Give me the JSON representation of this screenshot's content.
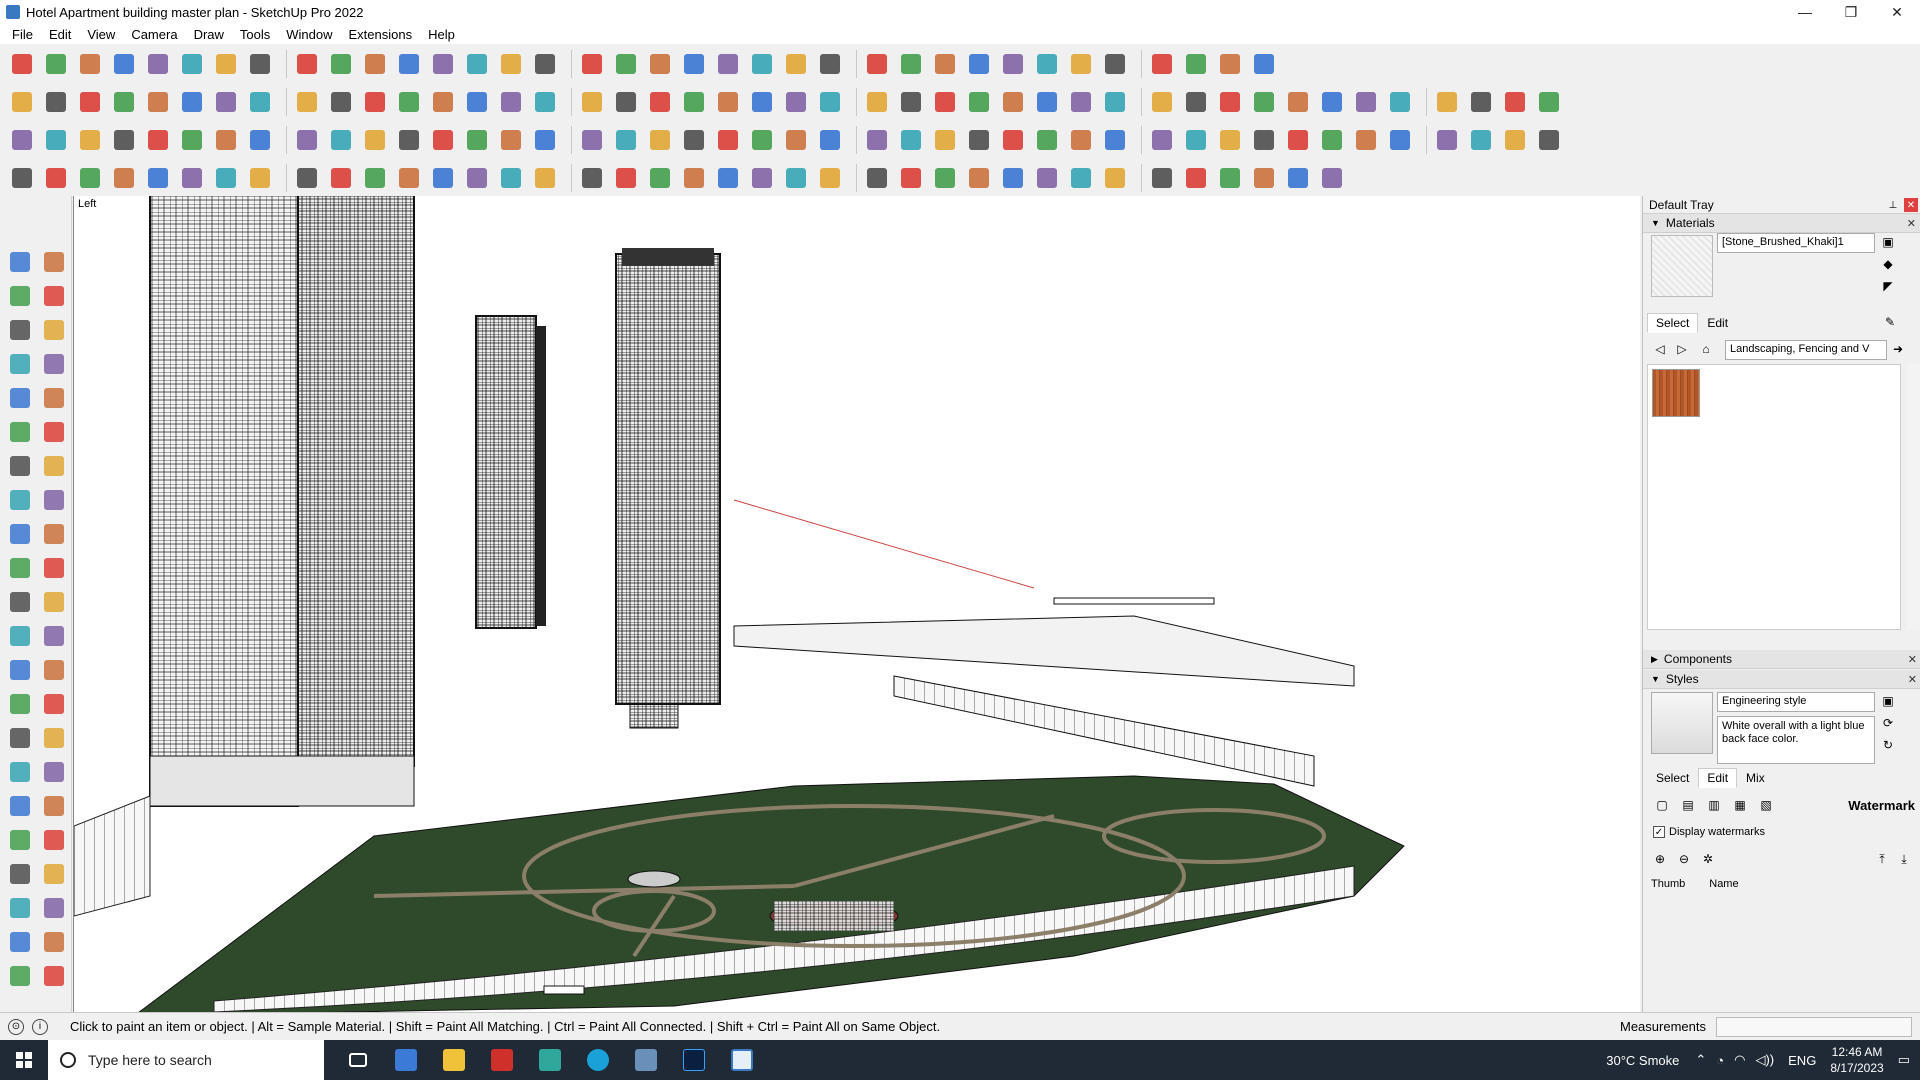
{
  "window": {
    "title": "Hotel Apartment building master plan - SketchUp Pro 2022",
    "controls": [
      "—",
      "❐",
      "✕"
    ]
  },
  "menu": [
    "File",
    "Edit",
    "View",
    "Camera",
    "Draw",
    "Tools",
    "Window",
    "Extensions",
    "Help"
  ],
  "viewport": {
    "view_label": "Left"
  },
  "tray": {
    "title": "Default Tray",
    "materials": {
      "panel_title": "Materials",
      "current_material": "[Stone_Brushed_Khaki]1",
      "tabs": [
        "Select",
        "Edit"
      ],
      "library": "Landscaping, Fencing and V"
    },
    "components": {
      "panel_title": "Components"
    },
    "styles": {
      "panel_title": "Styles",
      "style_name": "Engineering style",
      "style_description": "White overall with a light blue back face color.",
      "tabs": [
        "Select",
        "Edit",
        "Mix"
      ],
      "section": "Watermark",
      "display_watermarks_label": "Display watermarks",
      "display_watermarks_checked": true,
      "columns": [
        "Thumb",
        "Name"
      ]
    }
  },
  "status": {
    "hint": "Click to paint an item or object. | Alt = Sample Material. | Shift = Paint All Matching. | Ctrl = Paint All Connected. | Shift + Ctrl = Paint All on Same Object.",
    "measurements_label": "Measurements"
  },
  "taskbar": {
    "search_placeholder": "Type here to search",
    "weather": "30°C  Smoke",
    "language": "ENG",
    "time": "12:46 AM",
    "date": "8/17/2023"
  },
  "colors": {
    "ground": "#2f4a2a",
    "building_line": "#111111",
    "accent_red": "#d9342b",
    "accent_blue": "#2f6fd0"
  }
}
